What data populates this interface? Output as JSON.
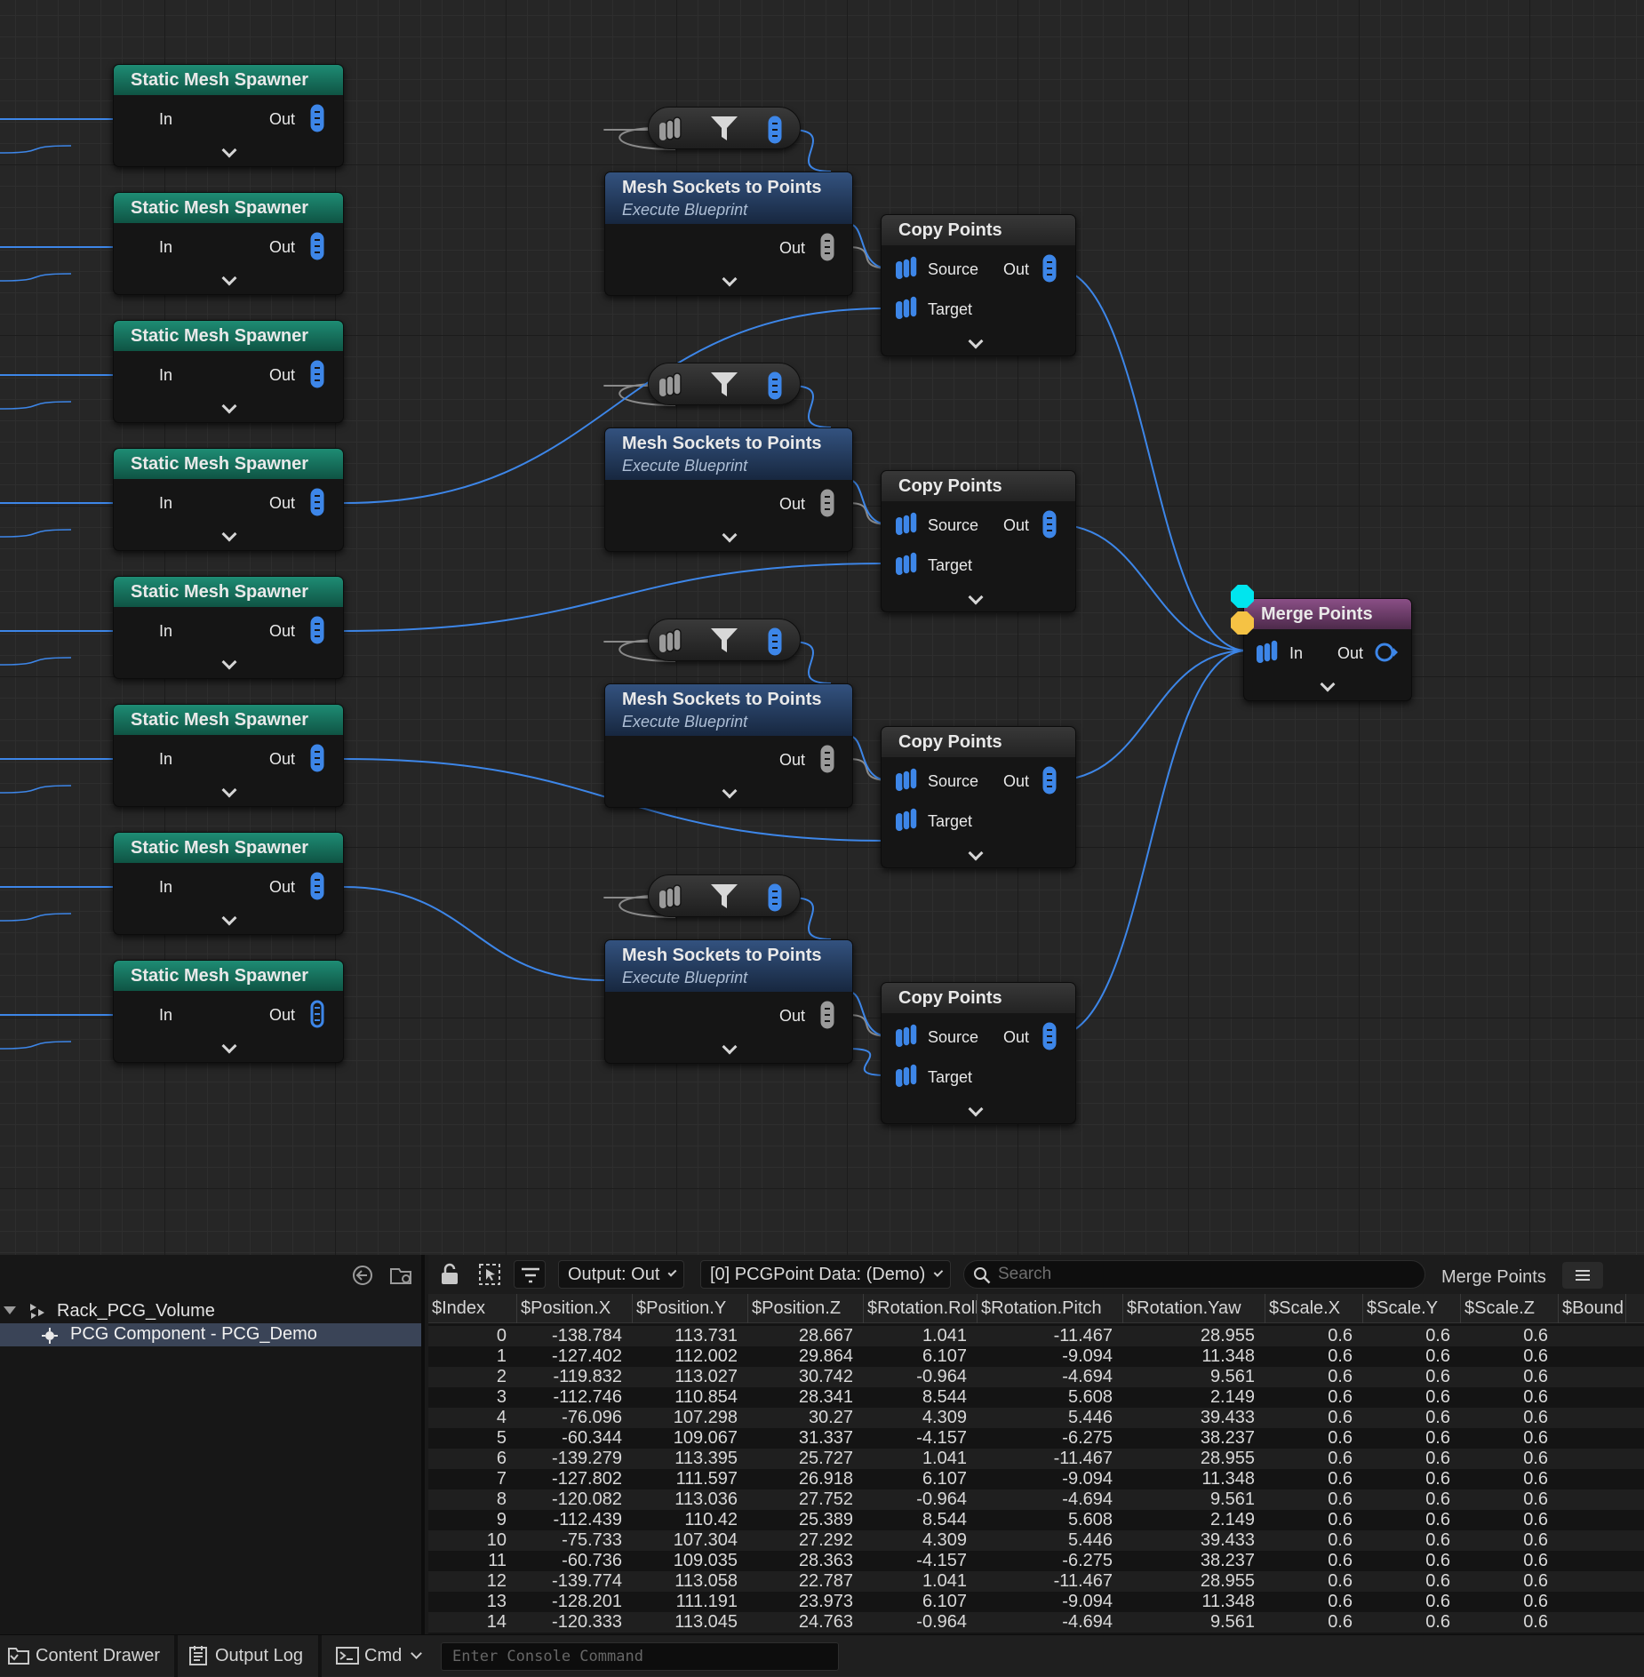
{
  "nodes": {
    "static_mesh_spawner": {
      "title": "Static Mesh Spawner",
      "in": "In",
      "out": "Out",
      "count": 8
    },
    "mesh_sockets": {
      "title": "Mesh Sockets to Points",
      "subtitle": "Execute Blueprint",
      "out": "Out",
      "count": 4
    },
    "copy_points": {
      "title": "Copy Points",
      "source": "Source",
      "target": "Target",
      "out": "Out",
      "count": 4
    },
    "merge_points": {
      "title": "Merge Points",
      "in": "In",
      "out": "Out"
    }
  },
  "colors": {
    "spawner_header": "#1e8c74",
    "sockets_header": "#33527f",
    "merge_header": "#8a4f86",
    "wire": "#3d86e8",
    "pin": "#3d86e8",
    "debug_cyan": "#00e5ee",
    "debug_yellow": "#f5c244",
    "selection": "#3a4457"
  },
  "outliner": {
    "items": [
      {
        "label": "Rack_PCG_Volume",
        "icon": "pcg-volume-icon"
      },
      {
        "label": "PCG Component - PCG_Demo",
        "icon": "component-icon",
        "selected": true
      }
    ]
  },
  "data_view": {
    "output_combo": "Output: Out",
    "data_combo": "[0] PCGPoint Data: (Demo)",
    "search_placeholder": "Search",
    "node_label": "Merge Points",
    "columns": [
      "$Index",
      "$Position.X",
      "$Position.Y",
      "$Position.Z",
      "$Rotation.Roll",
      "$Rotation.Pitch",
      "$Rotation.Yaw",
      "$Scale.X",
      "$Scale.Y",
      "$Scale.Z",
      "$Bound"
    ],
    "rows": [
      [
        "0",
        "-138.784",
        "113.731",
        "28.667",
        "1.041",
        "-11.467",
        "28.955",
        "0.6",
        "0.6",
        "0.6"
      ],
      [
        "1",
        "-127.402",
        "112.002",
        "29.864",
        "6.107",
        "-9.094",
        "11.348",
        "0.6",
        "0.6",
        "0.6"
      ],
      [
        "2",
        "-119.832",
        "113.027",
        "30.742",
        "-0.964",
        "-4.694",
        "9.561",
        "0.6",
        "0.6",
        "0.6"
      ],
      [
        "3",
        "-112.746",
        "110.854",
        "28.341",
        "8.544",
        "5.608",
        "2.149",
        "0.6",
        "0.6",
        "0.6"
      ],
      [
        "4",
        "-76.096",
        "107.298",
        "30.27",
        "4.309",
        "5.446",
        "39.433",
        "0.6",
        "0.6",
        "0.6"
      ],
      [
        "5",
        "-60.344",
        "109.067",
        "31.337",
        "-4.157",
        "-6.275",
        "38.237",
        "0.6",
        "0.6",
        "0.6"
      ],
      [
        "6",
        "-139.279",
        "113.395",
        "25.727",
        "1.041",
        "-11.467",
        "28.955",
        "0.6",
        "0.6",
        "0.6"
      ],
      [
        "7",
        "-127.802",
        "111.597",
        "26.918",
        "6.107",
        "-9.094",
        "11.348",
        "0.6",
        "0.6",
        "0.6"
      ],
      [
        "8",
        "-120.082",
        "113.036",
        "27.752",
        "-0.964",
        "-4.694",
        "9.561",
        "0.6",
        "0.6",
        "0.6"
      ],
      [
        "9",
        "-112.439",
        "110.42",
        "25.389",
        "8.544",
        "5.608",
        "2.149",
        "0.6",
        "0.6",
        "0.6"
      ],
      [
        "10",
        "-75.733",
        "107.304",
        "27.292",
        "4.309",
        "5.446",
        "39.433",
        "0.6",
        "0.6",
        "0.6"
      ],
      [
        "11",
        "-60.736",
        "109.035",
        "28.363",
        "-4.157",
        "-6.275",
        "38.237",
        "0.6",
        "0.6",
        "0.6"
      ],
      [
        "12",
        "-139.774",
        "113.058",
        "22.787",
        "1.041",
        "-11.467",
        "28.955",
        "0.6",
        "0.6",
        "0.6"
      ],
      [
        "13",
        "-128.201",
        "111.191",
        "23.973",
        "6.107",
        "-9.094",
        "11.348",
        "0.6",
        "0.6",
        "0.6"
      ],
      [
        "14",
        "-120.333",
        "113.045",
        "24.763",
        "-0.964",
        "-4.694",
        "9.561",
        "0.6",
        "0.6",
        "0.6"
      ]
    ]
  },
  "status_bar": {
    "content_drawer": "Content Drawer",
    "output_log": "Output Log",
    "cmd": "Cmd",
    "console_placeholder": "Enter Console Command"
  }
}
